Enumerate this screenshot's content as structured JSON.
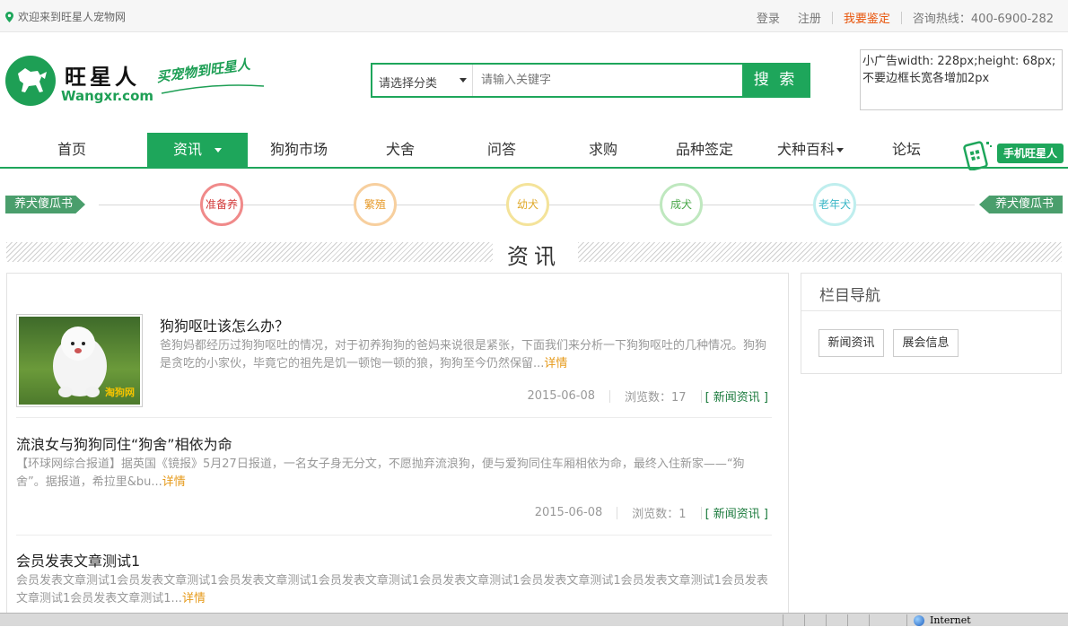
{
  "topbar": {
    "welcome": "欢迎来到旺星人宠物网",
    "login": "登录",
    "register": "注册",
    "appraise": "我要鉴定",
    "hotline": "咨询热线：400-6900-282"
  },
  "logo": {
    "name": "旺星人",
    "domain": "Wangxr.com",
    "slogan": "买宠物到旺星人"
  },
  "search": {
    "category": "请选择分类",
    "placeholder": "请输入关键字",
    "button": "搜 索"
  },
  "ad": {
    "text": "小广告width: 228px;height: 68px;不要边框长宽各增加2px"
  },
  "nav": {
    "items": [
      "首页",
      "资讯",
      "狗狗市场",
      "犬舍",
      "问答",
      "求购",
      "品种签定",
      "犬种百科",
      "论坛"
    ],
    "mobile": "手机旺星人"
  },
  "stages": {
    "left_flag": "养犬傻瓜书",
    "right_flag": "养犬傻瓜书",
    "nodes": [
      {
        "label": "准备养",
        "color": "#f08a8a",
        "text_color": "#d23a3a"
      },
      {
        "label": "繁殖",
        "color": "#f7cf9e",
        "text_color": "#e69a2a"
      },
      {
        "label": "幼犬",
        "color": "#f4e39a",
        "text_color": "#e0a92a"
      },
      {
        "label": "成犬",
        "color": "#bfe8bf",
        "text_color": "#4aa84a"
      },
      {
        "label": "老年犬",
        "color": "#bfeeee",
        "text_color": "#3bb7c7"
      }
    ]
  },
  "section": {
    "title": "资讯"
  },
  "articles": [
    {
      "title": "狗狗呕吐该怎么办？",
      "summary": "爸狗妈都经历过狗狗呕吐的情况，对于初养狗狗的爸妈来说很是紧张，下面我们来分析一下狗狗呕吐的几种情况。狗狗是贪吃的小家伙，毕竟它的祖先是饥一顿饱一顿的狼，狗狗至今仍然保留...",
      "more": "详情",
      "date": "2015-06-08",
      "views": "浏览数：17",
      "tag": "[ 新闻资讯 ]",
      "thumb_watermark": "淘狗网"
    },
    {
      "title": "流浪女与狗狗同住“狗舍”相依为命",
      "summary": "【环球网综合报道】据英国《镜报》5月27日报道，一名女子身无分文，不愿抛弃流浪狗，便与爱狗同住车厢相依为命，最终入住新家——“狗舍”。据报道，希拉里&bu...",
      "more": "详情",
      "date": "2015-06-08",
      "views": "浏览数：1",
      "tag": "[ 新闻资讯 ]"
    },
    {
      "title": "会员发表文章测试1",
      "summary": "会员发表文章测试1会员发表文章测试1会员发表文章测试1会员发表文章测试1会员发表文章测试1会员发表文章测试1会员发表文章测试1会员发表文章测试1会员发表文章测试1...",
      "more": "详情"
    }
  ],
  "sidebar": {
    "title": "栏目导航",
    "tags": [
      "新闻资讯",
      "展会信息"
    ]
  },
  "statusbar": {
    "zone": "Internet"
  },
  "colors": {
    "brand_green": "#1ea65b",
    "hot_orange": "#e8540a",
    "more_orange": "#e69a1a"
  }
}
